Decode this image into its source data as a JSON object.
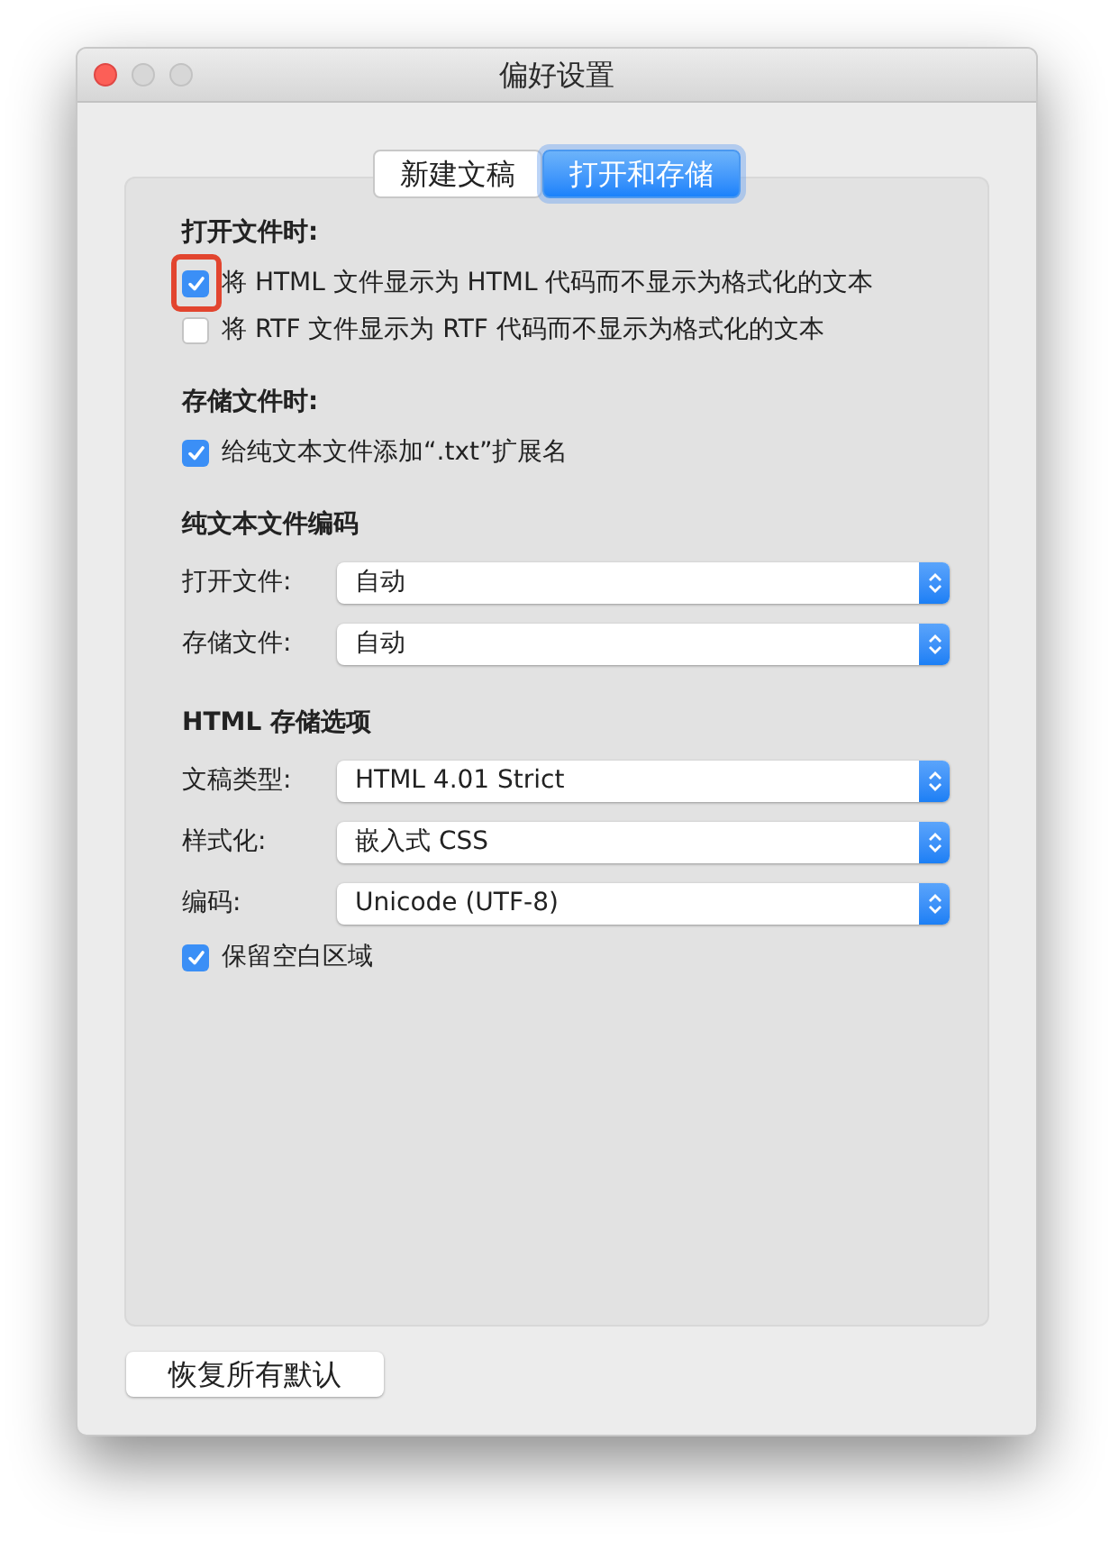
{
  "window": {
    "title": "偏好设置"
  },
  "tabs": [
    {
      "label": "新建文稿",
      "selected": false
    },
    {
      "label": "打开和存储",
      "selected": true
    }
  ],
  "sections": [
    {
      "heading": "打开文件时:",
      "items": [
        {
          "kind": "checkbox",
          "label": "将 HTML 文件显示为 HTML 代码而不显示为格式化的文本",
          "checked": true,
          "highlighted": true
        },
        {
          "kind": "checkbox",
          "label": "将 RTF 文件显示为 RTF 代码而不显示为格式化的文本",
          "checked": false,
          "highlighted": false
        }
      ]
    },
    {
      "heading": "存储文件时:",
      "items": [
        {
          "kind": "checkbox",
          "label": "给纯文本文件添加“.txt”扩展名",
          "checked": true,
          "highlighted": false
        }
      ]
    },
    {
      "heading": "纯文本文件编码",
      "items": [
        {
          "kind": "select",
          "label": "打开文件:",
          "value": "自动"
        },
        {
          "kind": "select",
          "label": "存储文件:",
          "value": "自动"
        }
      ]
    },
    {
      "heading": "HTML 存储选项",
      "items": [
        {
          "kind": "select",
          "label": "文稿类型:",
          "value": "HTML 4.01 Strict"
        },
        {
          "kind": "select",
          "label": "样式化:",
          "value": "嵌入式 CSS"
        },
        {
          "kind": "select",
          "label": "编码:",
          "value": "Unicode (UTF-8)"
        },
        {
          "kind": "checkbox",
          "label": "保留空白区域",
          "checked": true,
          "highlighted": false
        }
      ]
    }
  ],
  "buttons": [
    "恢复所有默认"
  ]
}
